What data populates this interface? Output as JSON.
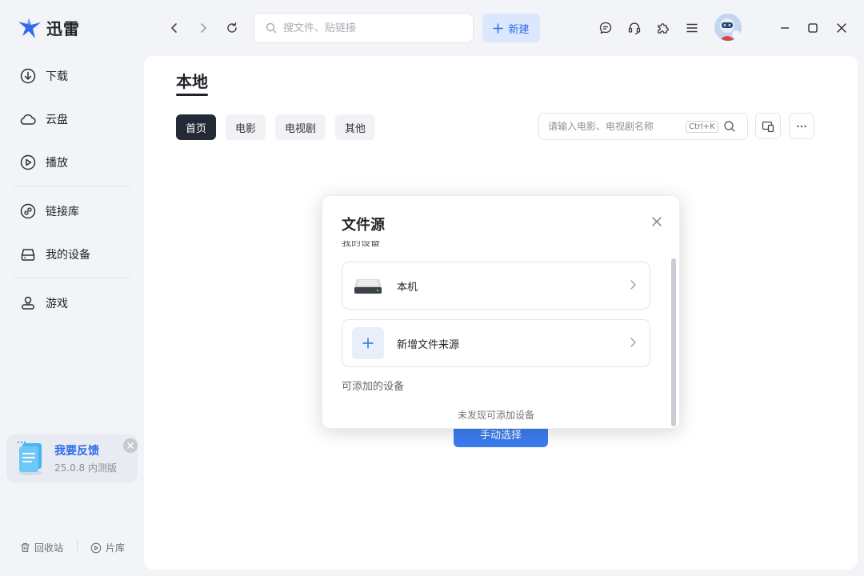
{
  "app": {
    "name": "迅雷"
  },
  "topbar": {
    "search_placeholder": "搜文件、贴链接",
    "new_label": "新建"
  },
  "sidebar": {
    "items": [
      {
        "label": "下载",
        "icon": "download-icon"
      },
      {
        "label": "云盘",
        "icon": "cloud-icon"
      },
      {
        "label": "播放",
        "icon": "play-icon"
      },
      {
        "label": "链接库",
        "icon": "link-icon"
      },
      {
        "label": "我的设备",
        "icon": "drive-icon"
      },
      {
        "label": "游戏",
        "icon": "game-icon"
      }
    ],
    "feedback": {
      "title": "我要反馈",
      "version": "25.0.8 内测版"
    },
    "bottom": {
      "trash_label": "回收站",
      "library_label": "片库"
    }
  },
  "main": {
    "title": "本地",
    "tabs": [
      {
        "label": "首页",
        "active": true
      },
      {
        "label": "电影",
        "active": false
      },
      {
        "label": "电视剧",
        "active": false
      },
      {
        "label": "其他",
        "active": false
      }
    ],
    "search_placeholder": "请输入电影、电视剧名称",
    "shortcut": "Ctrl+K",
    "manual_select_label": "手动选择"
  },
  "modal": {
    "title": "文件源",
    "section_mine": "我的设备",
    "sources": [
      {
        "label": "本机",
        "icon": "hard-drive-icon"
      },
      {
        "label": "新增文件来源",
        "icon": "plus-icon"
      }
    ],
    "section_addable": "可添加的设备",
    "empty_text": "未发现可添加设备"
  },
  "colors": {
    "accent": "#3a7cf0",
    "brand": "#2f6bea",
    "active_tab": "#232a36",
    "page_bg": "#f3f4f8"
  }
}
